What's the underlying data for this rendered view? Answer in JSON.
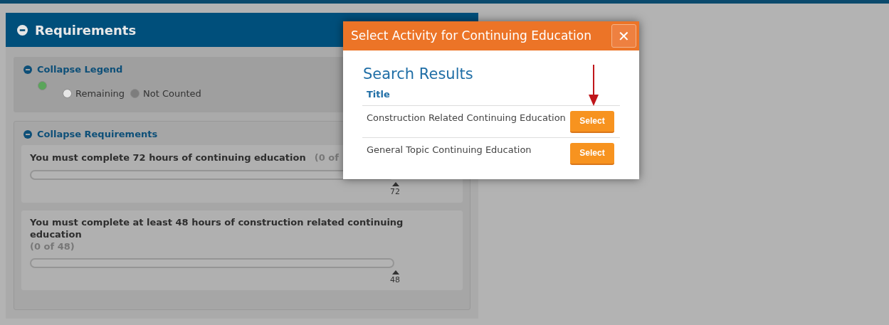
{
  "panel": {
    "title": "Requirements"
  },
  "legend": {
    "title": "Collapse Legend",
    "items": [
      {
        "color": "#5aa55a"
      },
      {
        "label": "Remaining",
        "color": "#e6e6e6"
      },
      {
        "label": "Not Counted",
        "color": "#7d7d7d"
      }
    ]
  },
  "requirements_section": {
    "title": "Collapse Requirements",
    "items": [
      {
        "text": "You must complete 72 hours of continuing education",
        "count": "(0 of",
        "marker": "72",
        "count_below": false
      },
      {
        "text": "You must complete at least 48 hours of construction related continuing education",
        "count": "(0 of 48)",
        "marker": "48",
        "count_below": true
      }
    ]
  },
  "dialog": {
    "title": "Select Activity for Continuing Education",
    "close": "✕",
    "heading": "Search Results",
    "column": "Title",
    "rows": [
      {
        "title": "Construction Related Continuing Education",
        "button": "Select",
        "pointed": true
      },
      {
        "title": "General Topic Continuing Education",
        "button": "Select",
        "pointed": false
      }
    ]
  }
}
